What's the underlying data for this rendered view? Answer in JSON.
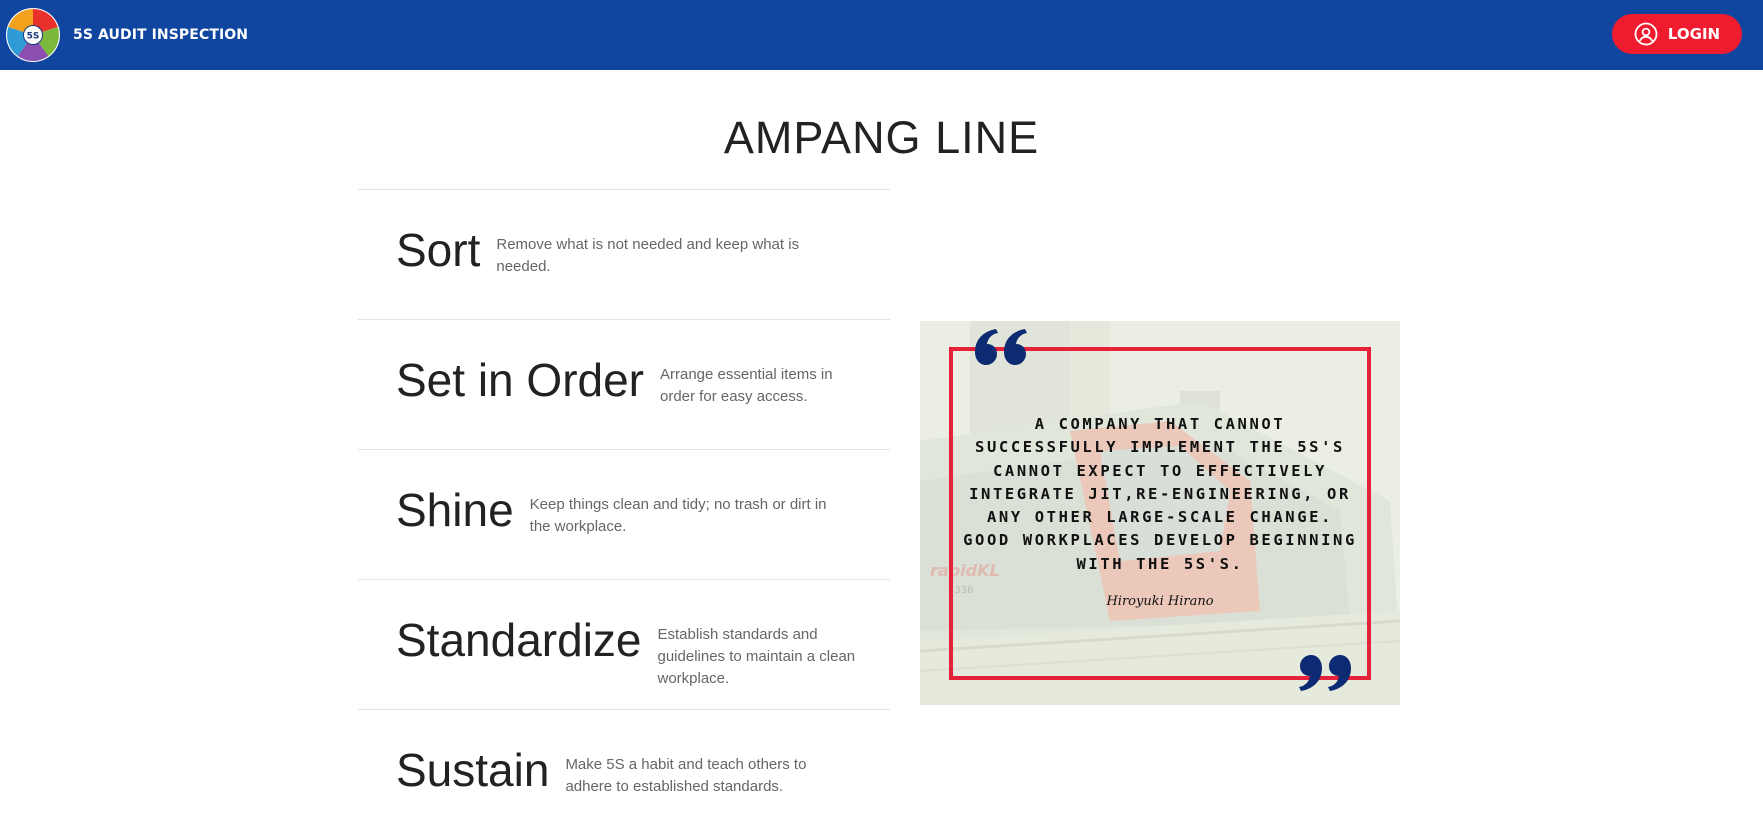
{
  "header": {
    "logo_text": "5S",
    "title": "5S AUDIT INSPECTION",
    "login_label": "LOGIN"
  },
  "main": {
    "title": "AMPANG LINE",
    "principles": [
      {
        "name": "Sort",
        "description": "Remove what is not needed and keep what is needed."
      },
      {
        "name": "Set in Order",
        "description": "Arrange essential items in order for easy access."
      },
      {
        "name": "Shine",
        "description": "Keep things clean and tidy; no trash or dirt in the workplace."
      },
      {
        "name": "Standardize",
        "description": "Establish standards and guidelines to maintain a clean workplace."
      },
      {
        "name": "Sustain",
        "description": "Make 5S a habit and teach others to adhere to established standards."
      }
    ]
  },
  "quote": {
    "text": "A COMPANY THAT CANNOT SUCCESSFULLY IMPLEMENT THE 5S'S CANNOT EXPECT TO EFFECTIVELY INTEGRATE JIT,RE-ENGINEERING, OR ANY OTHER LARGE-SCALE CHANGE. GOOD WORKPLACES DEVELOP BEGINNING WITH THE 5S'S.",
    "author": "Hiroyuki Hirano",
    "background_labels": [
      "rapidKL",
      "4336"
    ]
  },
  "colors": {
    "nav_bg": "#1045a0",
    "login_bg": "#ee1c2e",
    "frame": "#e8213a",
    "quote_mark": "#0d2b73"
  }
}
